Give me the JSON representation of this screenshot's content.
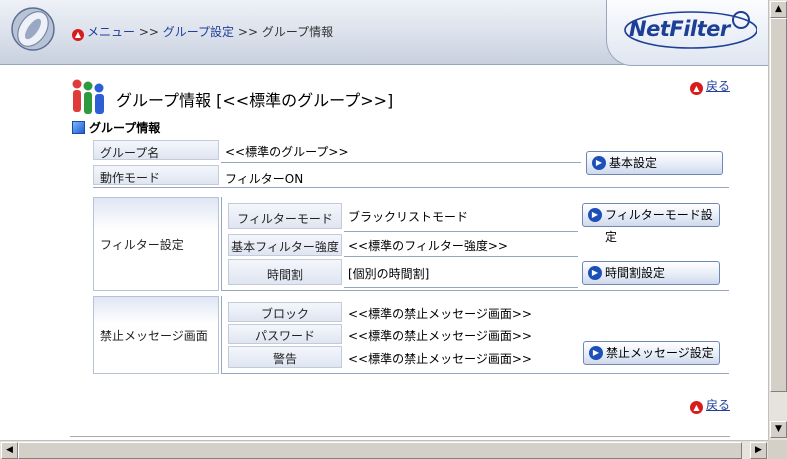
{
  "breadcrumb": {
    "menu": "メニュー",
    "sep1": ">>",
    "group_settings": "グループ設定",
    "sep2": ">>",
    "current": "グループ情報"
  },
  "brand": {
    "logo_text": "NetFilter"
  },
  "back_label": "戻る",
  "page_title": "グループ情報 [<<標準のグループ>>]",
  "section_title": "グループ情報",
  "rows": {
    "group_name": {
      "label": "グループ名",
      "value": "<<標準のグループ>>"
    },
    "action_mode": {
      "label": "動作モード",
      "value": "フィルターON"
    }
  },
  "filter_settings": {
    "label": "フィルター設定",
    "mode": {
      "label": "フィルターモード",
      "value": "ブラックリストモード"
    },
    "basic_strength": {
      "label": "基本フィルター強度",
      "value": "<<標準のフィルター強度>>"
    },
    "timetable": {
      "label": "時間割",
      "value": "[個別の時間割]"
    }
  },
  "block_message": {
    "label": "禁止メッセージ画面",
    "block": {
      "label": "ブロック",
      "value": "<<標準の禁止メッセージ画面>>"
    },
    "password": {
      "label": "パスワード",
      "value": "<<標準の禁止メッセージ画面>>"
    },
    "warning": {
      "label": "警告",
      "value": "<<標準の禁止メッセージ画面>>"
    }
  },
  "buttons": {
    "basic_settings": "基本設定",
    "filter_mode_settings": "フィルターモード設定",
    "timetable_settings": "時間割設定",
    "block_message_settings": "禁止メッセージ設定"
  },
  "colors": {
    "accent": "#1d4fb8",
    "back_icon": "#d81b1b",
    "brand": "#1d3f95"
  },
  "icons": {
    "back": "red-up-arrow-icon",
    "button": "blue-right-arrow-icon",
    "scroll_up": "up-arrow-icon",
    "scroll_down": "down-arrow-icon",
    "scroll_left": "left-arrow-icon",
    "scroll_right": "right-arrow-icon"
  }
}
